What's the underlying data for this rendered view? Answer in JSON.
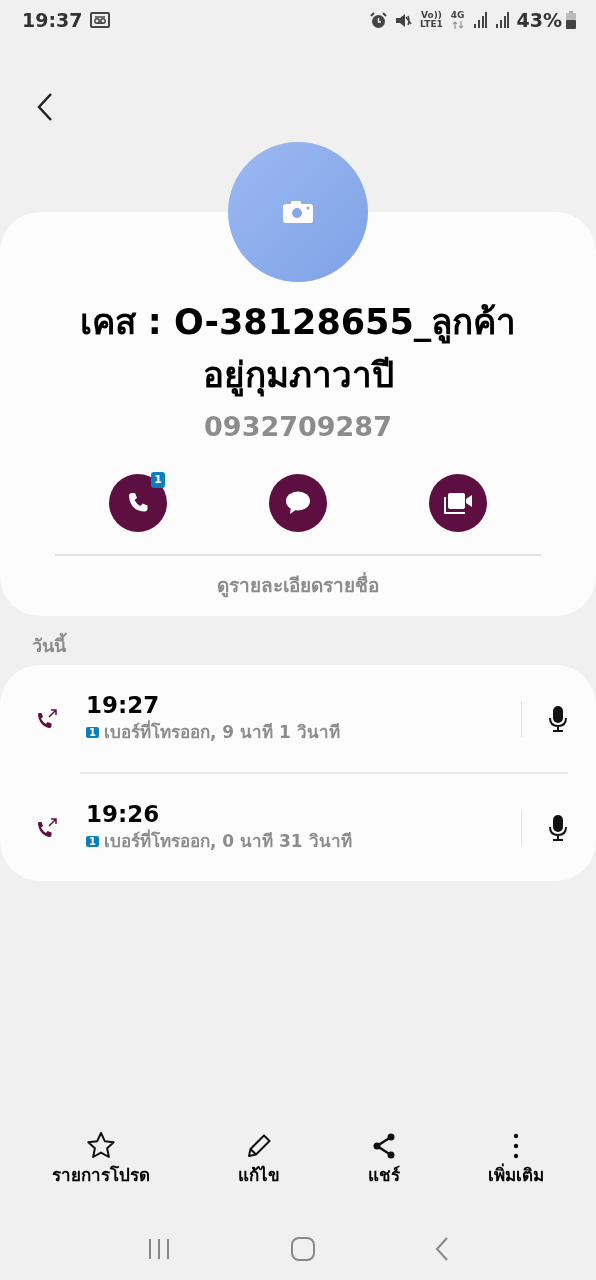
{
  "status_bar": {
    "time": "19:37",
    "network_labels": [
      "Vo))",
      "LTE1",
      "4G"
    ],
    "battery": "43%"
  },
  "contact": {
    "name": "เคส : O-38128655_ลูกค้าอยู่กุมภาวาปี",
    "number": "0932709287"
  },
  "actions": [
    {
      "kind": "call",
      "badge": "1"
    },
    {
      "kind": "message"
    },
    {
      "kind": "video"
    }
  ],
  "details_link": "ดูรายละเอียดรายชื่อ",
  "section_label": "วันนี้",
  "calls": [
    {
      "time": "19:27",
      "sim": "1",
      "detail": "เบอร์ที่โทรออก, 9 นาที 1 วินาที"
    },
    {
      "time": "19:26",
      "sim": "1",
      "detail": "เบอร์ที่โทรออก, 0 นาที 31 วินาที"
    }
  ],
  "bottom_actions": [
    {
      "kind": "star",
      "label": "รายการโปรด"
    },
    {
      "kind": "edit",
      "label": "แก้ไข"
    },
    {
      "kind": "share",
      "label": "แชร์"
    },
    {
      "kind": "more",
      "label": "เพิ่มเติม"
    }
  ]
}
